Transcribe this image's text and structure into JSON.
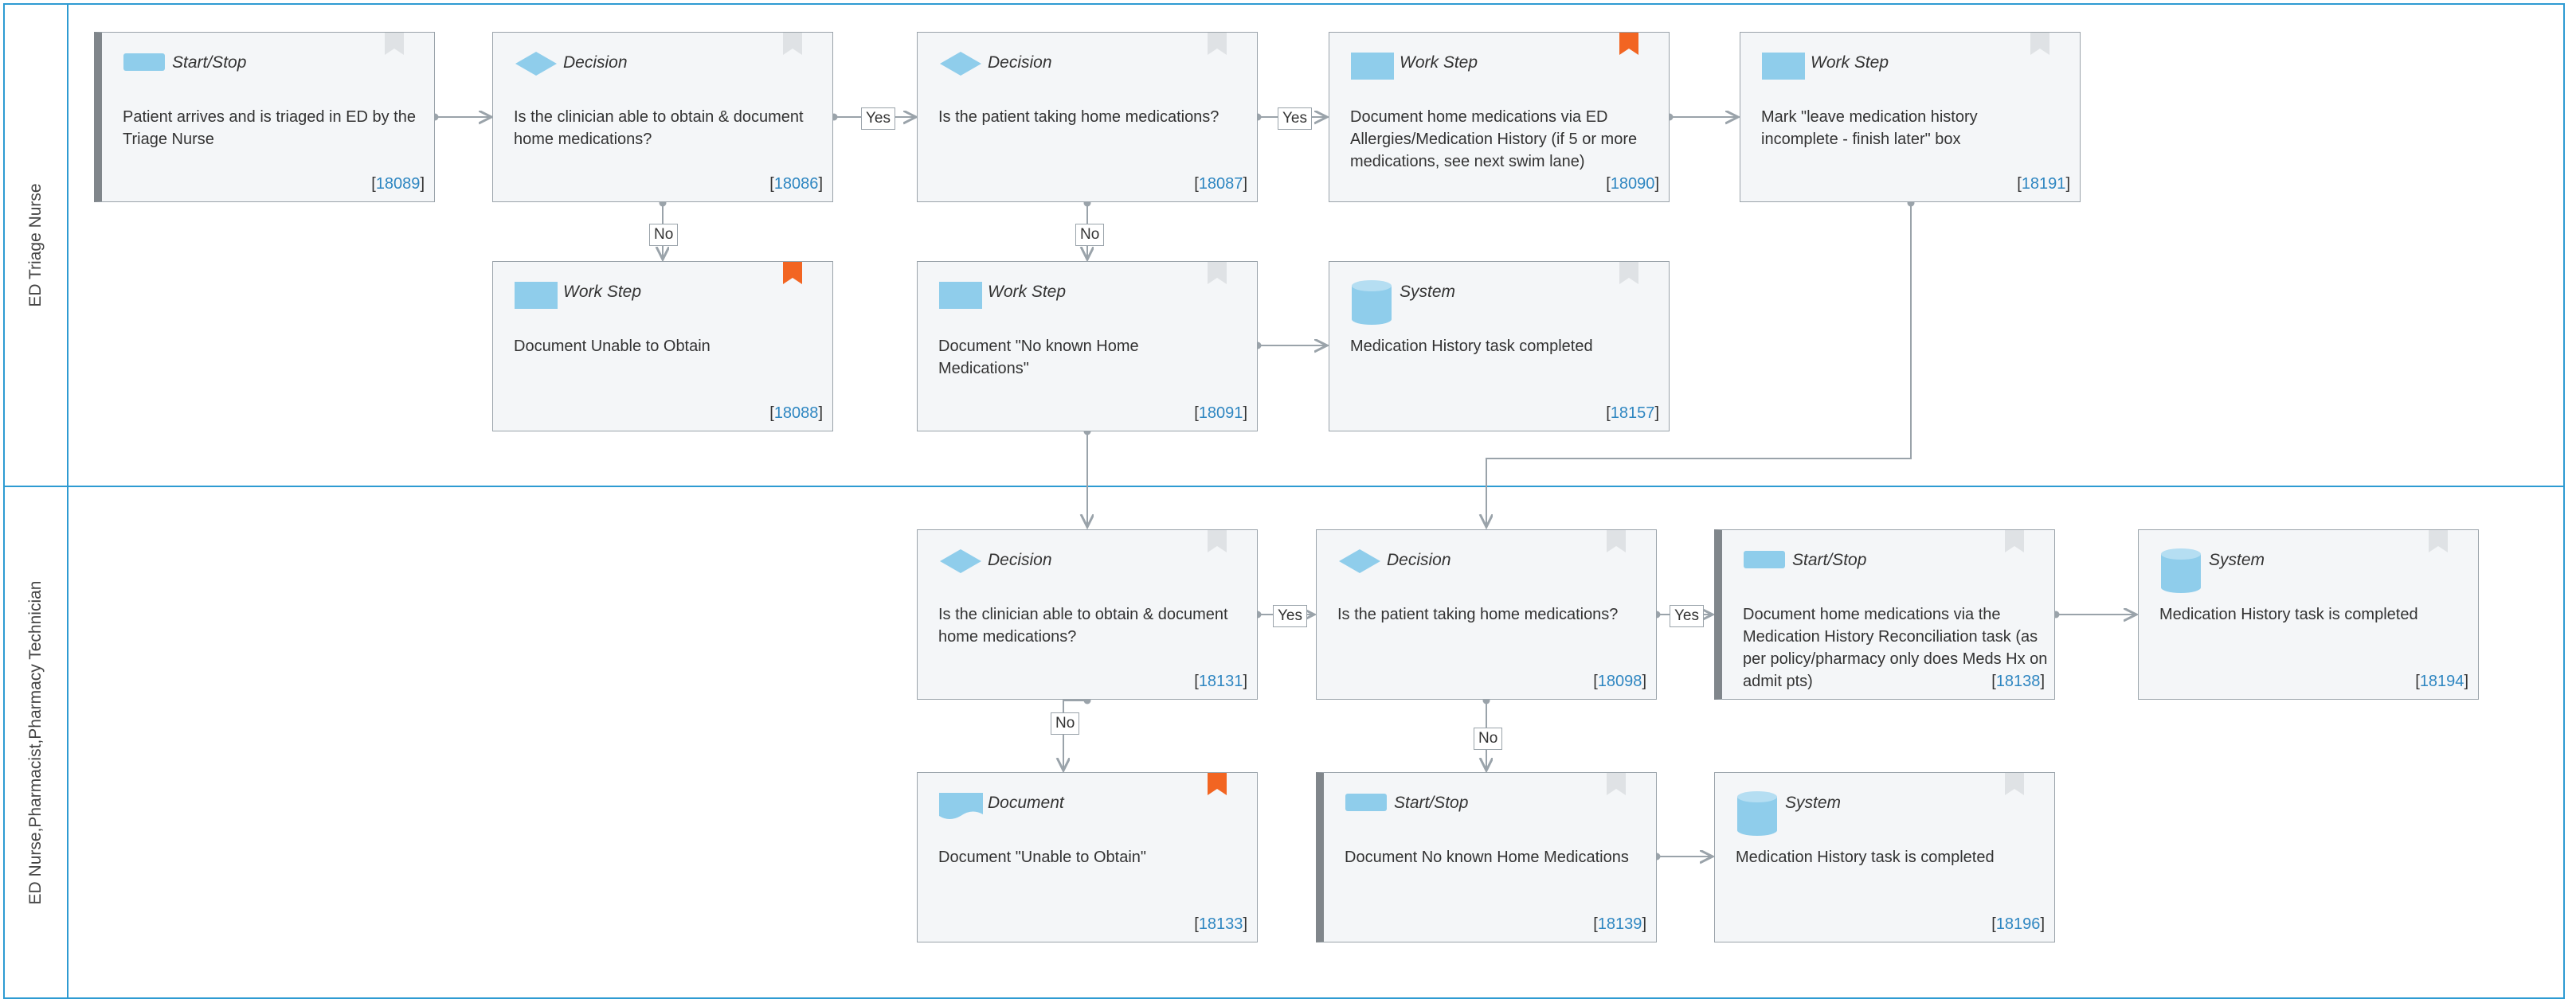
{
  "lanes": [
    {
      "label": "ED Triage Nurse"
    },
    {
      "label": "ED Nurse,Pharmacist,Pharmacy Technician"
    }
  ],
  "cards": [
    {
      "type": "Start/Stop",
      "text": "Patient arrives and is triaged in ED by the Triage Nurse",
      "id": "18089",
      "flag": "grey"
    },
    {
      "type": "Decision",
      "text": "Is the clinician able to obtain & document home medications?",
      "id": "18086",
      "flag": "grey"
    },
    {
      "type": "Decision",
      "text": "Is the patient taking home medications?",
      "id": "18087",
      "flag": "grey"
    },
    {
      "type": "Work Step",
      "text": "Document home medications via ED Allergies/Medication History (if 5 or more medications, see next swim lane)",
      "id": "18090",
      "flag": "orange"
    },
    {
      "type": "Work Step",
      "text": "Mark \"leave medication history incomplete - finish later\" box",
      "id": "18191",
      "flag": "grey"
    },
    {
      "type": "Work Step",
      "text": "Document Unable to Obtain",
      "id": "18088",
      "flag": "orange"
    },
    {
      "type": "Work Step",
      "text": "Document \"No known Home Medications\"",
      "id": "18091",
      "flag": "grey"
    },
    {
      "type": "System",
      "text": "Medication History task completed",
      "id": "18157",
      "flag": "grey"
    },
    {
      "type": "Decision",
      "text": "Is the clinician able to obtain & document home medications?",
      "id": "18131",
      "flag": "grey"
    },
    {
      "type": "Decision",
      "text": "Is the patient taking home medications?",
      "id": "18098",
      "flag": "grey"
    },
    {
      "type": "Start/Stop",
      "text": "Document home medications via the Medication History Reconciliation task (as per policy/pharmacy only does Meds Hx on admit pts)",
      "id": "18138",
      "flag": "grey"
    },
    {
      "type": "System",
      "text": "Medication History task is completed",
      "id": "18194",
      "flag": "grey"
    },
    {
      "type": "Document",
      "text": "Document \"Unable to Obtain\"",
      "id": "18133",
      "flag": "orange"
    },
    {
      "type": "Start/Stop",
      "text": "Document No known Home Medications",
      "id": "18139",
      "flag": "grey"
    },
    {
      "type": "System",
      "text": "Medication History task is completed",
      "id": "18196",
      "flag": "grey"
    }
  ],
  "connector_labels": {
    "yes": "Yes",
    "no": "No"
  },
  "colors": {
    "lane_border": "#2e9bd2",
    "icon_fill": "#8fcdeb",
    "flag_orange": "#f26522",
    "flag_grey": "#dfe2e5",
    "id_link": "#2e86c1",
    "connector": "#9aa3aa"
  }
}
